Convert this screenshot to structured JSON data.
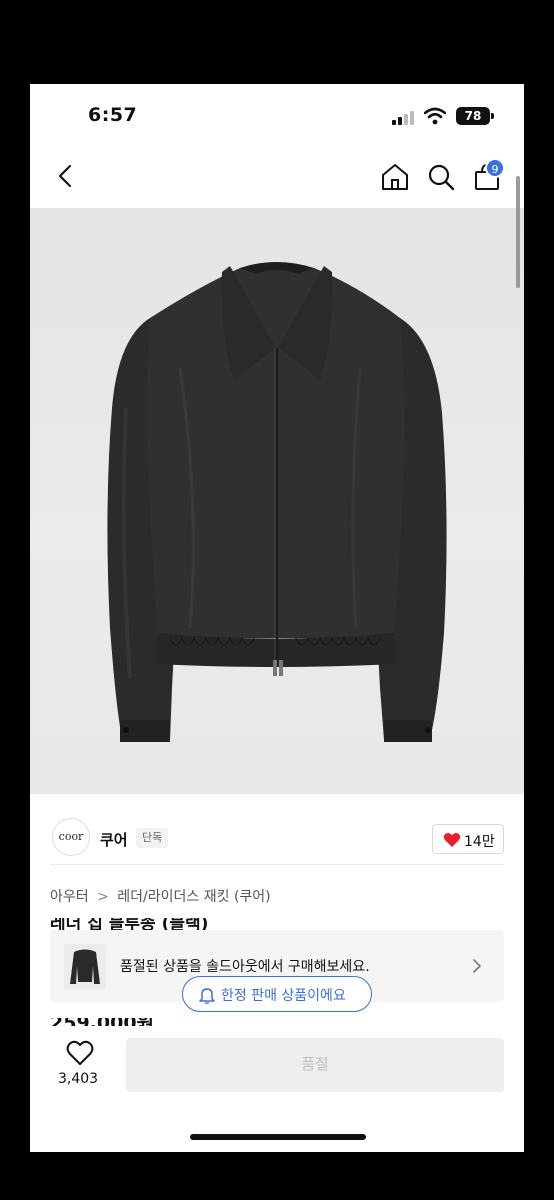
{
  "status_bar": {
    "time": "6:57",
    "battery": "78"
  },
  "nav": {
    "cart_count": "9"
  },
  "brand": {
    "logo_text": "coor",
    "name": "쿠어",
    "tag": "단독",
    "like_count": "14만"
  },
  "category": {
    "level1": "아우터",
    "separator": ">",
    "level2": "레더/라이더스 재킷 (쿠어)"
  },
  "product": {
    "title_partial": "레더 집 블루종 (블랙)",
    "price_partial": "259,000원"
  },
  "soldout_banner": {
    "text": "품절된 상품을 솔드아웃에서 구매해보세요."
  },
  "limited_pill": {
    "text": "한정 판매 상품이에요"
  },
  "bottom_bar": {
    "wish_count": "3,403",
    "action_label": "품절"
  },
  "colors": {
    "accent_blue": "#3a6fe0",
    "heart_red": "#e8202a",
    "jacket": "#2a2a2a"
  }
}
